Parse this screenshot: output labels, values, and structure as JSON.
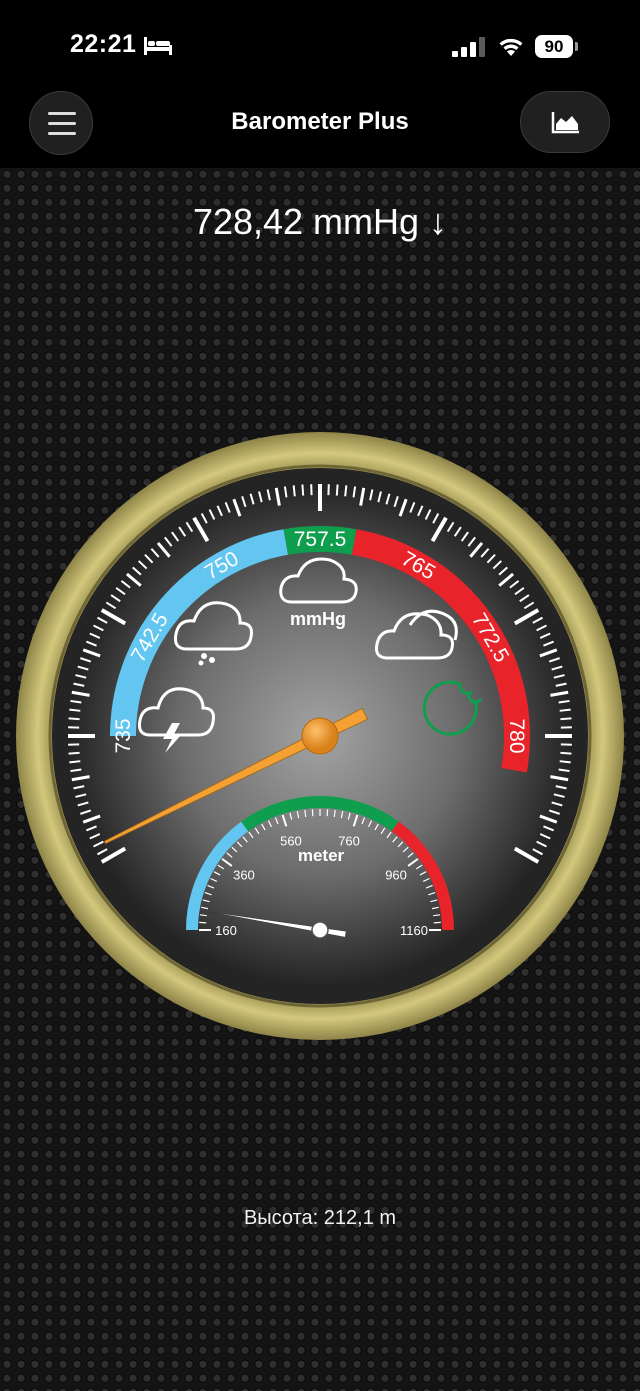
{
  "status_bar": {
    "time": "22:21",
    "battery": "90",
    "icons": [
      "bed-icon",
      "signal-icon",
      "wifi-icon",
      "battery-icon"
    ]
  },
  "header": {
    "title": "Barometer Plus",
    "menu_icon": "hamburger-menu-icon",
    "chart_icon": "area-chart-icon"
  },
  "reading": {
    "text": "728,42 mmHg ↓",
    "value": 728.42,
    "unit": "mmHg",
    "trend": "falling"
  },
  "gauge": {
    "unit_label": "mmHg",
    "scale_min": 727.5,
    "scale_max": 787.5,
    "value": 728.42,
    "labels": [
      "735",
      "742.5",
      "750",
      "757.5",
      "765",
      "772.5",
      "780"
    ],
    "bands": [
      {
        "name": "low",
        "from": 735,
        "to": 755,
        "color": "#62c6f1"
      },
      {
        "name": "normal",
        "from": 755,
        "to": 760,
        "color": "#0e9e4d"
      },
      {
        "name": "high",
        "from": 760,
        "to": 782.5,
        "color": "#e8242a"
      }
    ],
    "weather_icons": [
      "storm-cloud-icon",
      "rain-cloud-icon",
      "cloud-icon",
      "partly-cloudy-icon",
      "sun-icon"
    ],
    "needle_color": "#f4a033",
    "bezel_color": "#c6bb6b"
  },
  "altimeter": {
    "unit_label": "meter",
    "scale_min": 160,
    "scale_max": 1160,
    "labels": [
      "160",
      "360",
      "560",
      "760",
      "960",
      "1160"
    ],
    "value": 212.1,
    "bands": [
      {
        "name": "low",
        "from": 160,
        "to": 460,
        "color": "#62c6f1"
      },
      {
        "name": "mid",
        "from": 460,
        "to": 860,
        "color": "#0e9e4d"
      },
      {
        "name": "high",
        "from": 860,
        "to": 1160,
        "color": "#e8242a"
      }
    ]
  },
  "altitude_text": "Высота: 212,1 m"
}
